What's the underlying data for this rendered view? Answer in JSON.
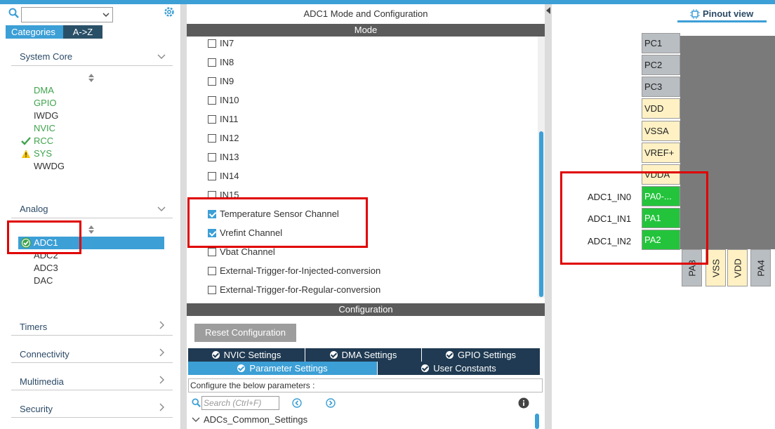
{
  "left": {
    "search": {
      "value": ""
    },
    "tabs": [
      {
        "label": "Categories"
      },
      {
        "label": "A->Z"
      }
    ],
    "system_core": {
      "title": "System Core",
      "items": [
        {
          "label": "DMA",
          "color": "#3fa34d",
          "status": ""
        },
        {
          "label": "GPIO",
          "color": "#3fa34d",
          "status": ""
        },
        {
          "label": "IWDG",
          "color": "#333333",
          "status": ""
        },
        {
          "label": "NVIC",
          "color": "#3fa34d",
          "status": ""
        },
        {
          "label": "RCC",
          "color": "#3fa34d",
          "status": "ok"
        },
        {
          "label": "SYS",
          "color": "#3fa34d",
          "status": "warning"
        },
        {
          "label": "WWDG",
          "color": "#333333",
          "status": ""
        }
      ]
    },
    "analog": {
      "title": "Analog",
      "items": [
        {
          "label": "ADC1",
          "selected": true
        },
        {
          "label": "ADC2"
        },
        {
          "label": "ADC3"
        },
        {
          "label": "DAC"
        }
      ]
    },
    "categories": [
      {
        "label": "Timers"
      },
      {
        "label": "Connectivity"
      },
      {
        "label": "Multimedia"
      },
      {
        "label": "Security"
      }
    ]
  },
  "middle": {
    "title": "ADC1 Mode and Configuration",
    "mode_header": "Mode",
    "mode_items": [
      {
        "label": "IN7",
        "checked": false
      },
      {
        "label": "IN8",
        "checked": false
      },
      {
        "label": "IN9",
        "checked": false
      },
      {
        "label": "IN10",
        "checked": false
      },
      {
        "label": "IN11",
        "checked": false
      },
      {
        "label": "IN12",
        "checked": false
      },
      {
        "label": "IN13",
        "checked": false
      },
      {
        "label": "IN14",
        "checked": false
      },
      {
        "label": "IN15",
        "checked": false
      },
      {
        "label": "Temperature Sensor Channel",
        "checked": true
      },
      {
        "label": "Vrefint Channel",
        "checked": true
      },
      {
        "label": "Vbat Channel",
        "checked": false
      },
      {
        "label": "External-Trigger-for-Injected-conversion",
        "checked": false
      },
      {
        "label": "External-Trigger-for-Regular-conversion",
        "checked": false
      }
    ],
    "config_header": "Configuration",
    "reset_label": "Reset Configuration",
    "tabs_row1": [
      "NVIC Settings",
      "DMA Settings",
      "GPIO Settings"
    ],
    "tabs_row2": [
      "Parameter Settings",
      "User Constants"
    ],
    "configure_text": "Configure the below parameters :",
    "param_search_placeholder": "Search (Ctrl+F)",
    "group_label": "ADCs_Common_Settings"
  },
  "right": {
    "tab_label": "Pinout view",
    "pins": [
      {
        "label": "PC1",
        "kind": "gray"
      },
      {
        "label": "PC2",
        "kind": "gray"
      },
      {
        "label": "PC3",
        "kind": "gray"
      },
      {
        "label": "VDD",
        "kind": "yellow"
      },
      {
        "label": "VSSA",
        "kind": "yellow"
      },
      {
        "label": "VREF+",
        "kind": "yellow"
      },
      {
        "label": "VDDA",
        "kind": "yellow"
      },
      {
        "label": "PA0-...",
        "kind": "green"
      },
      {
        "label": "PA1",
        "kind": "green"
      },
      {
        "label": "PA2",
        "kind": "green"
      }
    ],
    "signals": [
      "ADC1_IN0",
      "ADC1_IN1",
      "ADC1_IN2"
    ],
    "bottom_pins": [
      {
        "label": "PA3",
        "kind": "gray"
      },
      {
        "label": "VSS",
        "kind": "yellow"
      },
      {
        "label": "VDD",
        "kind": "yellow"
      },
      {
        "label": "PA4",
        "kind": "gray"
      }
    ]
  },
  "colors": {
    "accent": "#3c9fd6",
    "dark_tab": "#1f3a52",
    "pin_green": "#23c43c",
    "highlight": "#e00000"
  }
}
